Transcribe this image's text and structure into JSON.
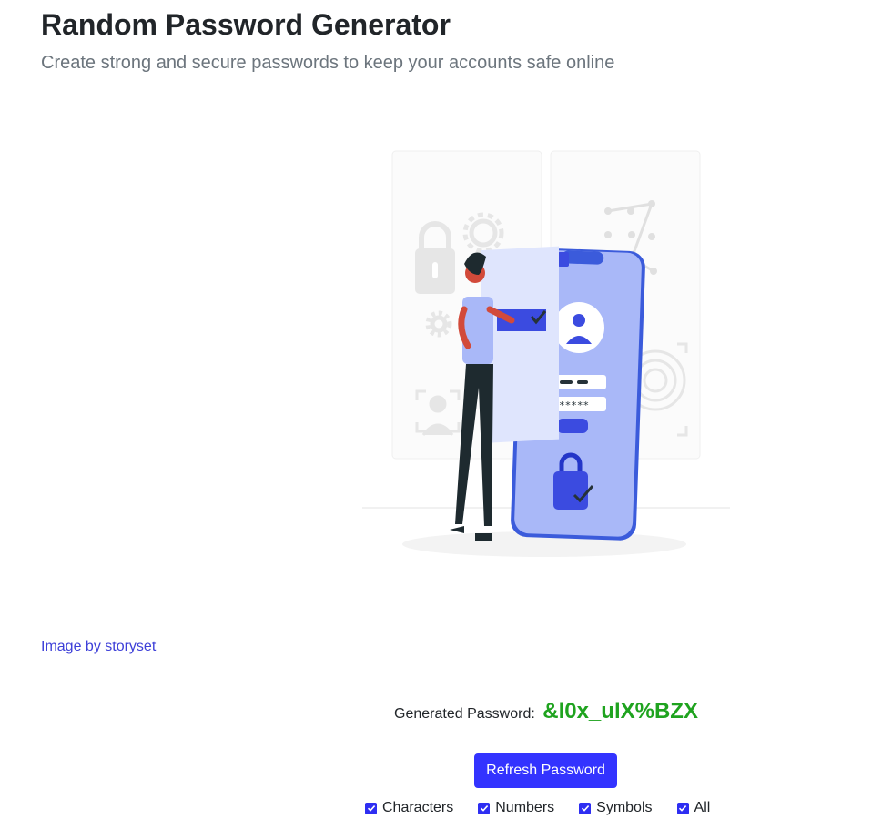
{
  "header": {
    "title": "Random Password Generator",
    "subtitle": "Create strong and secure passwords to keep your accounts safe online"
  },
  "illustration": {
    "icon": "password-security-illustration",
    "phone_password_mask": "*****"
  },
  "credit": {
    "label": "Image by storyset"
  },
  "result": {
    "label": "Generated Password:",
    "password": "&l0x_ulX%BZX"
  },
  "actions": {
    "refresh_label": "Refresh Password"
  },
  "options": [
    {
      "label": "Characters",
      "checked": true
    },
    {
      "label": "Numbers",
      "checked": true
    },
    {
      "label": "Symbols",
      "checked": true
    },
    {
      "label": "All",
      "checked": true
    }
  ],
  "colors": {
    "accent": "#3333ff",
    "password_text": "#1fa31f",
    "link": "#3d3fd8",
    "subtitle": "#6c757d"
  }
}
